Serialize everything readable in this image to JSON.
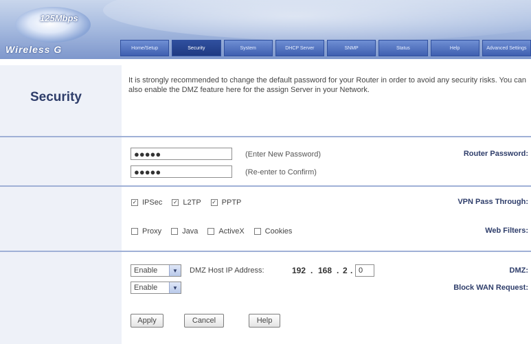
{
  "header": {
    "logo_speed": "125Mbps",
    "logo_product": "Wireless G",
    "nav_tabs": [
      "Home/Setup",
      "Security",
      "System",
      "DHCP Server",
      "SNMP",
      "Status",
      "Help",
      "Advanced Settings"
    ]
  },
  "page": {
    "title": "Security",
    "intro": "It is strongly recommended to change the default password for your Router in order to avoid any security risks. You can also enable the DMZ feature here for the assign Server in your Network."
  },
  "password": {
    "label": "Router Password:",
    "value1": "●●●●●",
    "value2": "●●●●●",
    "hint1": "(Enter New Password)",
    "hint2": "(Re-enter to Confirm)"
  },
  "vpn": {
    "label": "VPN Pass Through:",
    "options": [
      {
        "label": "IPSec",
        "checked": true
      },
      {
        "label": "L2TP",
        "checked": true
      },
      {
        "label": "PPTP",
        "checked": true
      }
    ]
  },
  "filters": {
    "label": "Web Filters:",
    "options": [
      {
        "label": "Proxy",
        "checked": false
      },
      {
        "label": "Java",
        "checked": false
      },
      {
        "label": "ActiveX",
        "checked": false
      },
      {
        "label": "Cookies",
        "checked": false
      }
    ]
  },
  "dmz": {
    "label": "DMZ:",
    "value": "Enable",
    "ip_label": "DMZ Host IP Address:",
    "ip1": "192",
    "ip2": "168",
    "ip3": "2",
    "ip4": "0",
    "dot": "."
  },
  "block_wan": {
    "label": "Block WAN Request:",
    "value": "Enable"
  },
  "buttons": {
    "apply": "Apply",
    "cancel": "Cancel",
    "help": "Help"
  },
  "icons": {
    "dropdown_arrow": "chevron-down-icon",
    "checkmark": "check-icon"
  }
}
